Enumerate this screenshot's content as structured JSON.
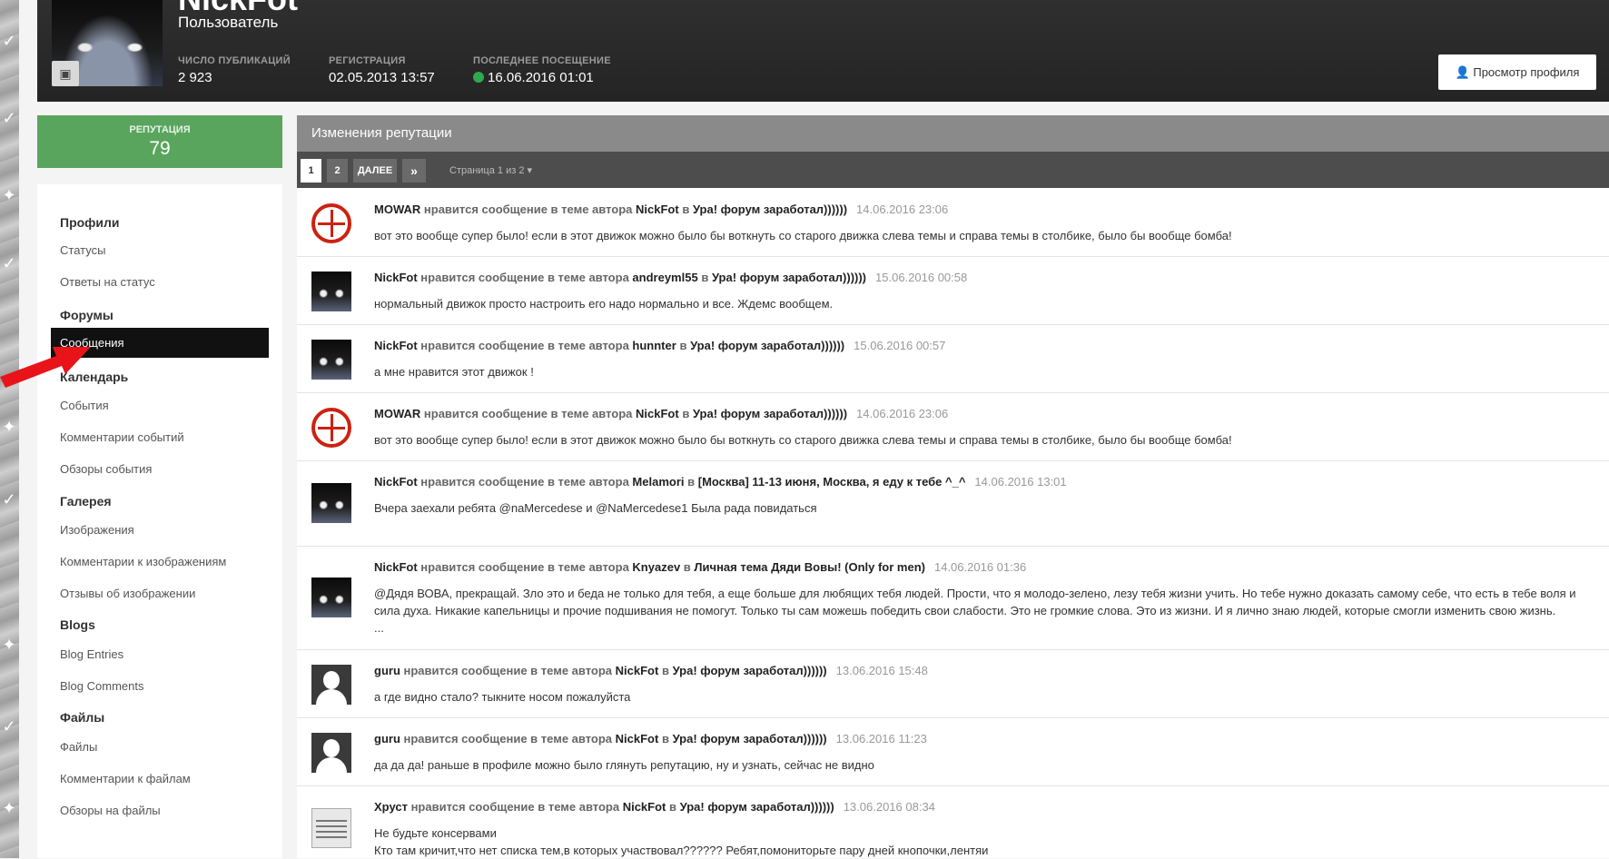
{
  "header": {
    "username": "NickFot",
    "user_title": "Пользователь",
    "stats": [
      {
        "label": "Число публикаций",
        "value": "2 923"
      },
      {
        "label": "Регистрация",
        "value": "02.05.2013 13:57"
      },
      {
        "label": "Последнее посещение",
        "value": "16.06.2016 01:01"
      }
    ],
    "view_profile": "Просмотр профиля"
  },
  "reputation": {
    "label": "РЕПУТАЦИЯ",
    "value": "79"
  },
  "sidebar": {
    "groups": [
      {
        "title": "Профили",
        "items": [
          "Статусы",
          "Ответы на статус"
        ]
      },
      {
        "title": "Форумы",
        "items": [
          "Сообщения"
        ]
      },
      {
        "title": "Календарь",
        "items": [
          "События",
          "Комментарии событий",
          "Обзоры события"
        ]
      },
      {
        "title": "Галерея",
        "items": [
          "Изображения",
          "Комментарии к изображениям",
          "Отзывы об изображении"
        ]
      },
      {
        "title": "Blogs",
        "items": [
          "Blog Entries",
          "Blog Comments"
        ]
      },
      {
        "title": "Файлы",
        "items": [
          "Файлы",
          "Комментарии к файлам",
          "Обзоры на файлы"
        ]
      }
    ],
    "active_item": "Сообщения"
  },
  "main": {
    "title": "Изменения репутации",
    "pager": {
      "page1": "1",
      "page2": "2",
      "next": "ДАЛЕЕ",
      "last": "»",
      "info": "Страница 1 из 2"
    },
    "items": [
      {
        "author": "MOWAR",
        "verb": "нравится сообщение в теме автора",
        "target": "NickFot",
        "prep": "в",
        "topic": "Ура! форум заработал))))))",
        "date": "14.06.2016 23:06",
        "text": "вот это вообще супер было! если в этот движок можно было бы воткнуть со старого движка слева темы и справа темы в столбике, было бы вообще бомба!"
      },
      {
        "author": "NickFot",
        "verb": "нравится сообщение в теме автора",
        "target": "andreyml55",
        "prep": "в",
        "topic": "Ура! форум заработал))))))",
        "date": "15.06.2016 00:58",
        "text": "нормальный движок просто настроить его надо нормально и все. Ждемс вообщем."
      },
      {
        "author": "NickFot",
        "verb": "нравится сообщение в теме автора",
        "target": "hunnter",
        "prep": "в",
        "topic": "Ура! форум заработал))))))",
        "date": "15.06.2016 00:57",
        "text": "а мне нравится этот движок !"
      },
      {
        "author": "MOWAR",
        "verb": "нравится сообщение в теме автора",
        "target": "NickFot",
        "prep": "в",
        "topic": "Ура! форум заработал))))))",
        "date": "14.06.2016 23:06",
        "text": "вот это вообще супер было! если в этот движок можно было бы воткнуть со старого движка слева темы и справа темы в столбике, было бы вообще бомба!"
      },
      {
        "author": "NickFot",
        "verb": "нравится сообщение в теме автора",
        "target": "Melamori",
        "prep": "в",
        "topic": "[Москва] 11-13 июня, Москва, я еду к тебе ^_^",
        "date": "14.06.2016 13:01",
        "text": "Вчера заехали ребята @naMercedese и @NaMercedese1  Была рада повидаться"
      },
      {
        "author": "NickFot",
        "verb": "нравится сообщение в теме автора",
        "target": "Knyazev",
        "prep": "в",
        "topic": "Личная тема Дяди Вовы! (Only for men)",
        "date": "14.06.2016 01:36",
        "text": "@Дядя ВОВА, прекращай. Зло это и беда не только для тебя, а еще больше для любящих тебя людей. Прости, что я молодо-зелено, лезу тебя жизни учить. Но тебе нужно доказать самому себе, что есть в тебе воля и сила духа. Никакие капельницы и прочие подшивания не помогут. Только ты сам можешь победить свои слабости. Это не громкие слова. Это из жизни. И я лично знаю людей, которые смогли изменить свою жизнь.",
        "more": "..."
      },
      {
        "author": "guru",
        "verb": "нравится сообщение в теме автора",
        "target": "NickFot",
        "prep": "в",
        "topic": "Ура! форум заработал))))))",
        "date": "13.06.2016 15:48",
        "text": "а где видно стало? тыкните носом пожалуйста"
      },
      {
        "author": "guru",
        "verb": "нравится сообщение в теме автора",
        "target": "NickFot",
        "prep": "в",
        "topic": "Ура! форум заработал))))))",
        "date": "13.06.2016 11:23",
        "text": "да да да! раньше в профиле можно было глянуть репутацию, ну и узнать, сейчас не видно"
      },
      {
        "author": "Хруст",
        "verb": "нравится сообщение в теме автора",
        "target": "NickFot",
        "prep": "в",
        "topic": "Ура! форум заработал))))))",
        "date": "13.06.2016 08:34",
        "text": "Не будьте консервами",
        "text2": "Кто там кричит,что нет списка тем,в которых участвовал?????? Ребят,помониторьте пару дней кнопочки,лентяи"
      }
    ]
  },
  "colors": {
    "header_bg": "#262626",
    "rep_bg": "#5aa55e",
    "title_bar": "#8a8a8a",
    "pager_bar": "#4d4d4d",
    "online": "#2ea94f"
  }
}
